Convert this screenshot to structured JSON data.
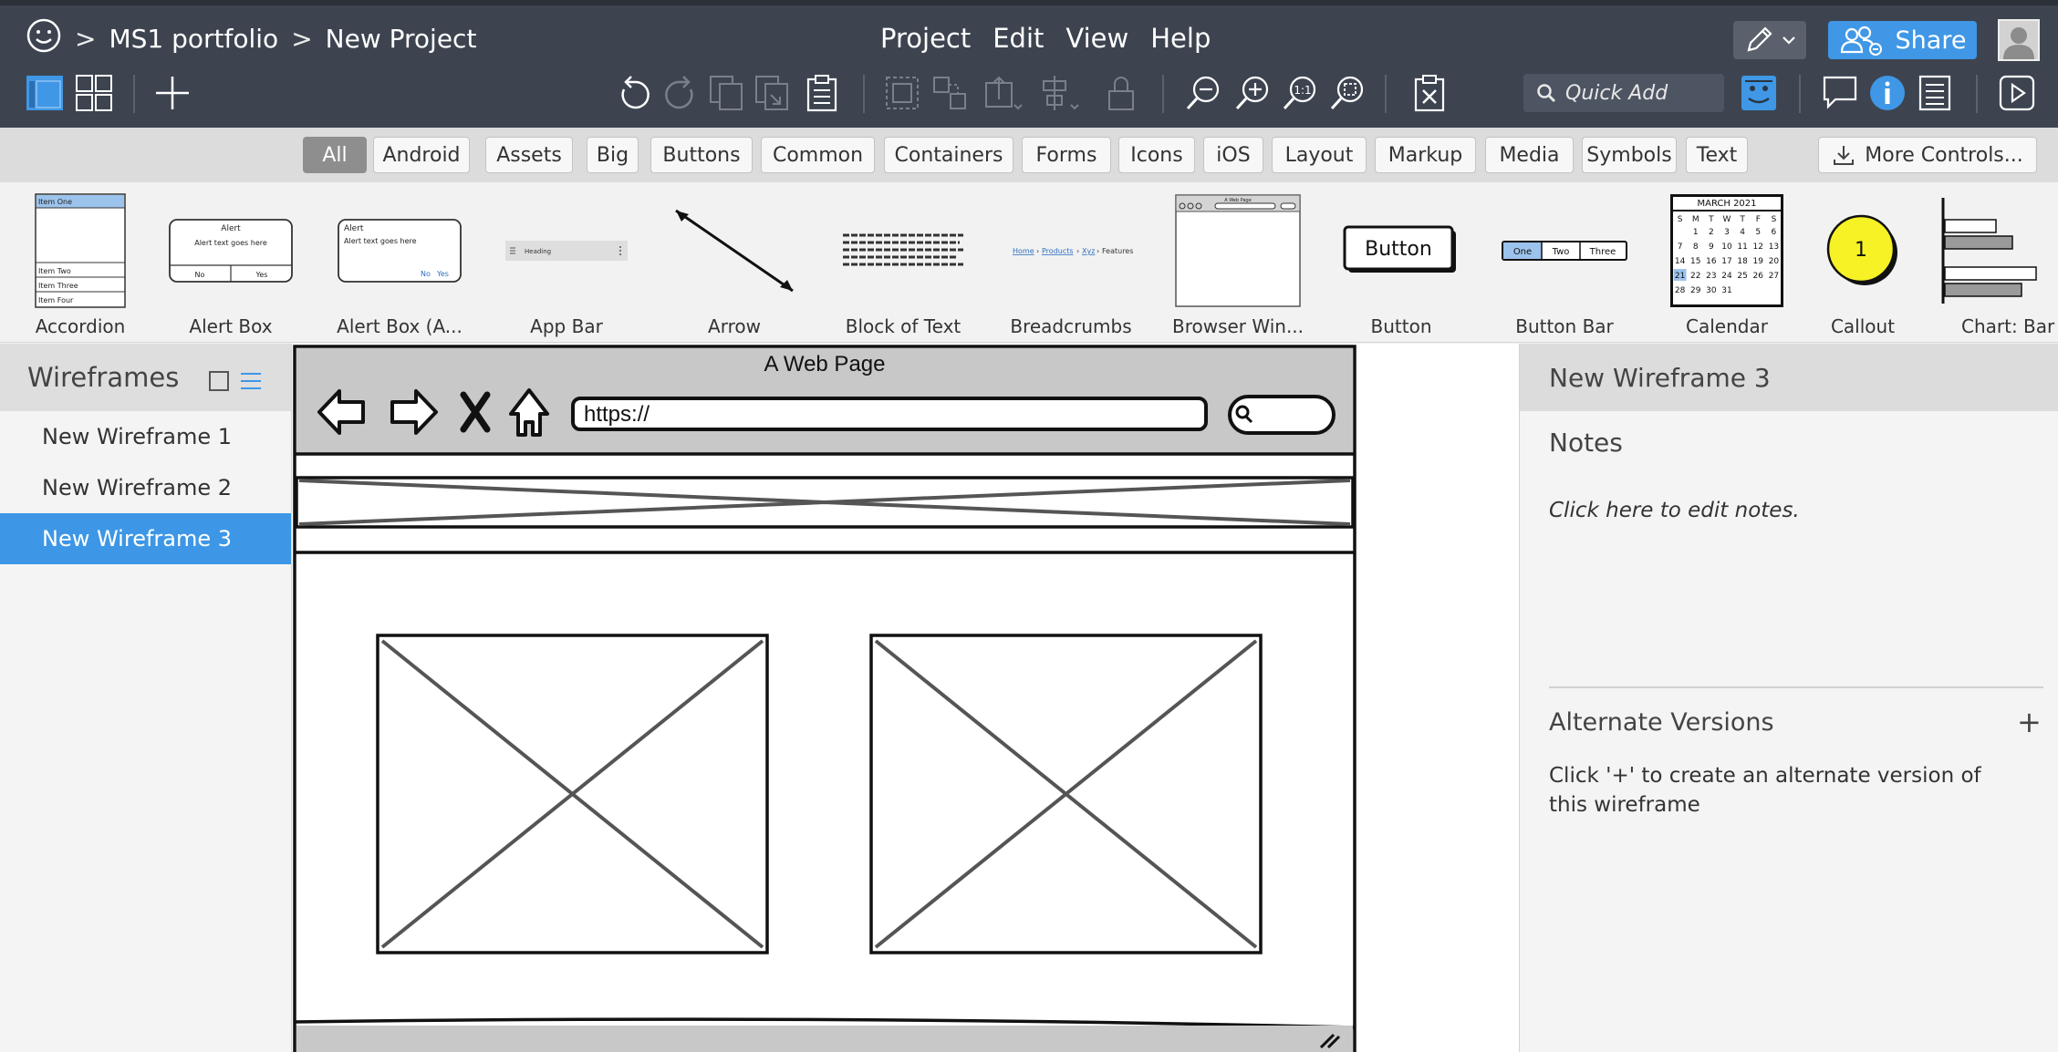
{
  "breadcrumb": {
    "project": "MS1 portfolio",
    "page": "New Project",
    "separator": ">"
  },
  "menu": [
    "Project",
    "Edit",
    "View",
    "Help"
  ],
  "quick_add": {
    "placeholder": "Quick Add"
  },
  "share_label": "Share",
  "filters": [
    "All",
    "Android",
    "Assets",
    "Big",
    "Buttons",
    "Common",
    "Containers",
    "Forms",
    "Icons",
    "iOS",
    "Layout",
    "Markup",
    "Media",
    "Symbols",
    "Text"
  ],
  "active_filter": "All",
  "more_controls": "More Controls...",
  "components": [
    "Accordion",
    "Alert Box",
    "Alert Box (A...",
    "App Bar",
    "Arrow",
    "Block of Text",
    "Breadcrumbs",
    "Browser Win...",
    "Button",
    "Button Bar",
    "Calendar",
    "Callout",
    "Chart: Bar"
  ],
  "thumbs": {
    "accordion": [
      "Item One",
      "Item Two",
      "Item Three",
      "Item Four"
    ],
    "alert_title": "Alert",
    "alert_text": "Alert text goes here",
    "alert_no": "No",
    "alert_yes": "Yes",
    "app_bar_heading": "Heading",
    "breadcrumbs": [
      "Home",
      "Products",
      "Xyz",
      "Features"
    ],
    "browser_title": "A Web Page",
    "button": "Button",
    "button_bar": [
      "One",
      "Two",
      "Three"
    ],
    "calendar_month": "MARCH 2021",
    "calendar_days": [
      "S",
      "M",
      "T",
      "W",
      "T",
      "F",
      "S"
    ],
    "calendar_dates": [
      "",
      "1",
      "2",
      "3",
      "4",
      "5",
      "6",
      "7",
      "8",
      "9",
      "10",
      "11",
      "12",
      "13",
      "14",
      "15",
      "16",
      "17",
      "18",
      "19",
      "20",
      "21",
      "22",
      "23",
      "24",
      "25",
      "26",
      "27",
      "28",
      "29",
      "30",
      "31"
    ],
    "callout": "1"
  },
  "wireframes": {
    "title": "Wireframes",
    "items": [
      "New Wireframe 1",
      "New Wireframe 2",
      "New Wireframe 3"
    ],
    "selected": "New Wireframe 3"
  },
  "canvas": {
    "page_title": "A Web Page",
    "url": "https://"
  },
  "inspector": {
    "title": "New Wireframe 3",
    "notes_label": "Notes",
    "notes_placeholder": "Click here to edit notes.",
    "alt_label": "Alternate Versions",
    "alt_plus": "+",
    "alt_help": "Click '+' to create an alternate version of this wireframe"
  },
  "colors": {
    "topbar": "#3d4450",
    "accent": "#3d97e6",
    "callout": "#f6f225"
  }
}
